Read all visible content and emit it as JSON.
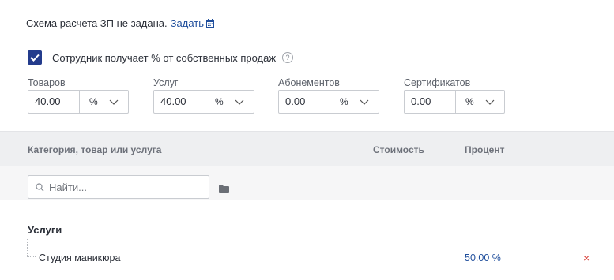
{
  "scheme": {
    "text": "Схема расчета ЗП не задана.",
    "link": "Задать",
    "icon": "calendar-icon"
  },
  "own_sales": {
    "label": "Сотрудник получает % от собственных продаж",
    "checked": true,
    "help": "?"
  },
  "fields": [
    {
      "label": "Товаров",
      "value": "40.00",
      "unit": "%"
    },
    {
      "label": "Услуг",
      "value": "40.00",
      "unit": "%"
    },
    {
      "label": "Абонементов",
      "value": "0.00",
      "unit": "%"
    },
    {
      "label": "Сертификатов",
      "value": "0.00",
      "unit": "%"
    }
  ],
  "table": {
    "headers": {
      "category": "Категория, товар или услуга",
      "cost": "Стоимость",
      "percent": "Процент"
    },
    "search_placeholder": "Найти...",
    "group": "Услуги",
    "rows": [
      {
        "label": "Студия маникюра",
        "percent": "50.00 %",
        "delete": "×"
      }
    ]
  },
  "colors": {
    "accent": "#233b8c",
    "link": "#1f4e9c",
    "delete": "#d9413a",
    "header_bg": "#eeeff1"
  }
}
